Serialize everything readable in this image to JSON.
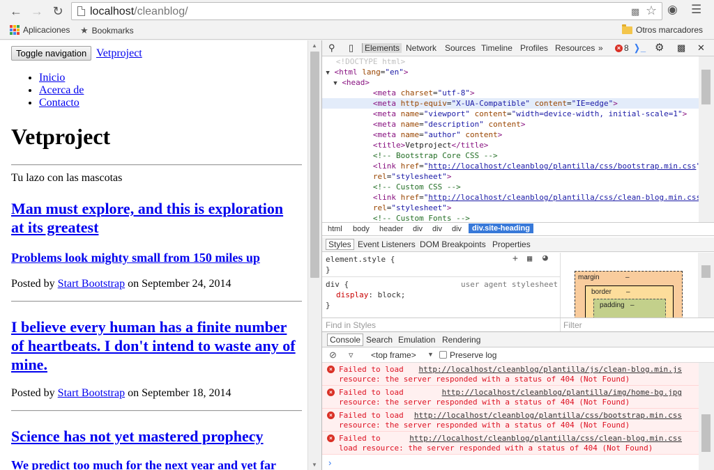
{
  "browser": {
    "url_host": "localhost",
    "url_path": "/cleanblog/",
    "bookmarks": {
      "apps": "Aplicaciones",
      "bookmarks": "Bookmarks",
      "other": "Otros marcadores"
    },
    "icons": {
      "back": "back-arrow-icon",
      "forward": "forward-arrow-icon",
      "reload": "reload-icon",
      "star": "star-icon",
      "menu": "menu-icon"
    }
  },
  "page": {
    "toggle_label": "Toggle navigation",
    "brand": "Vetproject",
    "nav": [
      "Inicio",
      "Acerca de",
      "Contacto"
    ],
    "site_title": "Vetproject",
    "tagline": "Tu lazo con las mascotas",
    "posts": [
      {
        "title": "Man must explore, and this is exploration at its greatest",
        "subtitle": "Problems look mighty small from 150 miles up",
        "meta_prefix": "Posted by ",
        "author": "Start Bootstrap",
        "meta_suffix": " on September 24, 2014"
      },
      {
        "title": "I believe every human has a finite number of heartbeats. I don't intend to waste any of mine.",
        "meta_prefix": "Posted by ",
        "author": "Start Bootstrap",
        "meta_suffix": " on September 18, 2014"
      },
      {
        "title": "Science has not yet mastered prophecy",
        "subtitle": "We predict too much for the next year and yet far"
      }
    ]
  },
  "devtools": {
    "tabs": [
      "Elements",
      "Network",
      "Sources",
      "Timeline",
      "Profiles",
      "Resources",
      "»"
    ],
    "active_tab": "Elements",
    "error_count": "8",
    "breadcrumbs": [
      "html",
      "body",
      "header",
      "div",
      "div",
      "div",
      "div.site-heading"
    ],
    "style_tabs": [
      "Styles",
      "Event Listeners",
      "DOM Breakpoints",
      "Properties"
    ],
    "styles": {
      "element_style": "element.style {",
      "close": "}",
      "div_selector": "div {",
      "ua_label": "user agent stylesheet",
      "prop_name": "display",
      "prop_value": ": block;"
    },
    "box_model": {
      "margin": "margin",
      "border": "border",
      "padding": "padding",
      "dash": "–"
    },
    "find_styles": "Find in Styles",
    "filter": "Filter",
    "drawer_tabs": [
      "Console",
      "Search",
      "Emulation",
      "Rendering"
    ],
    "frame": "<top frame>",
    "preserve_log": "Preserve log",
    "messages": [
      {
        "line1": "Failed to load",
        "url": "http://localhost/cleanblog/plantilla/js/clean-blog.min.js",
        "line2": "resource: the server responded with a status of 404 (Not Found)"
      },
      {
        "line1": "Failed to load",
        "url": "http://localhost/cleanblog/plantilla/img/home-bg.jpg",
        "line2": "resource: the server responded with a status of 404 (Not Found)"
      },
      {
        "line1": "Failed to load",
        "url": "http://localhost/cleanblog/plantilla/css/bootstrap.min.css",
        "line2": "resource: the server responded with a status of 404 (Not Found)"
      },
      {
        "line1": "Failed to",
        "url": "http://localhost/cleanblog/plantilla/css/clean-blog.min.css",
        "line2": "load resource: the server responded with a status of 404 (Not Found)"
      }
    ],
    "prompt": "›"
  }
}
